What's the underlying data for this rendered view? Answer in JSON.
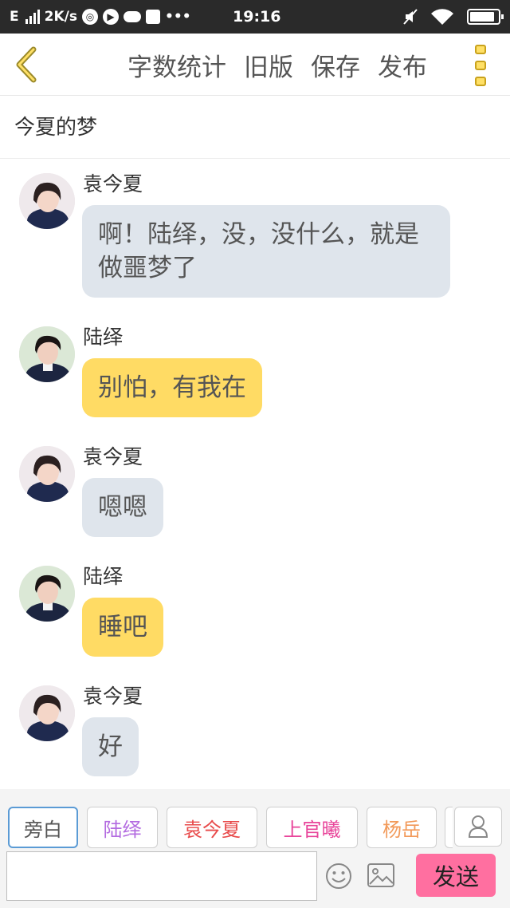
{
  "status_bar": {
    "carrier": "E",
    "speed": "2K/s",
    "time": "19:16"
  },
  "header": {
    "actions": [
      "字数统计",
      "旧版",
      "保存",
      "发布"
    ]
  },
  "title": "今夏的梦",
  "messages": [
    {
      "speaker": "袁今夏",
      "text": "啊！陆绎，没，没什么，就是做噩梦了",
      "style": "gray"
    },
    {
      "speaker": "陆绎",
      "text": "别怕，有我在",
      "style": "yellow"
    },
    {
      "speaker": "袁今夏",
      "text": "嗯嗯",
      "style": "gray"
    },
    {
      "speaker": "陆绎",
      "text": "睡吧",
      "style": "yellow"
    },
    {
      "speaker": "袁今夏",
      "text": "好",
      "style": "gray"
    }
  ],
  "roles": [
    {
      "name": "旁白",
      "color": "#555555",
      "active": true
    },
    {
      "name": "陆绎",
      "color": "#b36be0",
      "active": false
    },
    {
      "name": "袁今夏",
      "color": "#e84a4a",
      "active": false
    },
    {
      "name": "上官曦",
      "color": "#e8449a",
      "active": false
    },
    {
      "name": "杨岳",
      "color": "#f29a5a",
      "active": false
    }
  ],
  "input": {
    "value": "",
    "send_label": "发送"
  },
  "colors": {
    "accent": "#ffdb64",
    "bubble_gray": "#dfe5ec",
    "send": "#ff6fa0"
  }
}
